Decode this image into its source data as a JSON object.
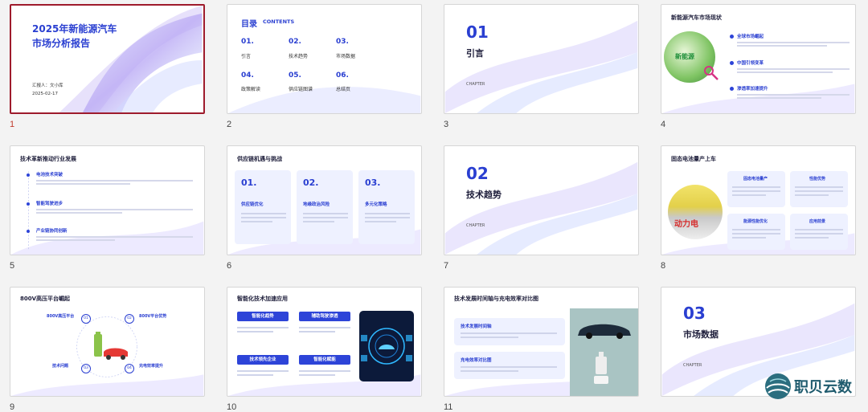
{
  "slides": [
    {
      "num": "1",
      "title_line1": "2025年新能源汽车",
      "title_line2": "市场分析报告",
      "reporter": "汇报人：文小库",
      "date": "2025-02-17"
    },
    {
      "num": "2",
      "toc_title": "目录",
      "toc_en": "CONTENTS",
      "items": [
        {
          "n": "01.",
          "label": "引言"
        },
        {
          "n": "02.",
          "label": "技术趋势"
        },
        {
          "n": "03.",
          "label": "市场数据"
        },
        {
          "n": "04.",
          "label": "政策解读"
        },
        {
          "n": "05.",
          "label": "供应链图谱"
        },
        {
          "n": "06.",
          "label": "总结页"
        }
      ]
    },
    {
      "num": "3",
      "big": "01",
      "title": "引言",
      "chapter": "CHAPTER"
    },
    {
      "num": "4",
      "title": "新能源汽车市场现状",
      "image_label": "新能源",
      "points": [
        "全球市场崛起",
        "中国引领变革",
        "渗透率加速提升"
      ]
    },
    {
      "num": "5",
      "title": "技术革新推动行业发展",
      "points": [
        "电池技术突破",
        "智能驾驶进步",
        "产业链协同创新"
      ]
    },
    {
      "num": "6",
      "title": "供应链机遇与挑战",
      "cards": [
        {
          "n": "01.",
          "label": "供应链优化"
        },
        {
          "n": "02.",
          "label": "地缘政治风险"
        },
        {
          "n": "03.",
          "label": "多元化策略"
        }
      ]
    },
    {
      "num": "7",
      "big": "02",
      "title": "技术趋势",
      "chapter": "CHAPTER"
    },
    {
      "num": "8",
      "title": "固态电池量产上车",
      "image_label": "动力电",
      "cards": [
        "固态电池量产",
        "性能优势",
        "能源性能优化",
        "应用前景"
      ]
    },
    {
      "num": "9",
      "title": "800V高压平台崛起",
      "items": [
        {
          "n": "01",
          "label": "800V高压平台"
        },
        {
          "n": "02",
          "label": "800V平台优势"
        },
        {
          "n": "03",
          "label": "技术问题"
        },
        {
          "n": "04",
          "label": "充电效率提升"
        }
      ]
    },
    {
      "num": "10",
      "title": "智能化技术加速应用",
      "pills": [
        "智能化趋势",
        "辅助驾驶渗透",
        "技术领先企业",
        "智能化赋能"
      ]
    },
    {
      "num": "11",
      "title": "技术发展时间轴与充电效率对比图",
      "cards": [
        "技术发展时间轴",
        "充电效率对比图"
      ]
    },
    {
      "num": "12",
      "big": "03",
      "title": "市场数据",
      "chapter": "CHAPTER"
    }
  ],
  "watermark": {
    "text": "职贝云数",
    "icon": "globe-logo-icon"
  },
  "colors": {
    "accent": "#2a3fd1",
    "selected_border": "#9e1b2c",
    "selected_number": "#c0392b"
  }
}
